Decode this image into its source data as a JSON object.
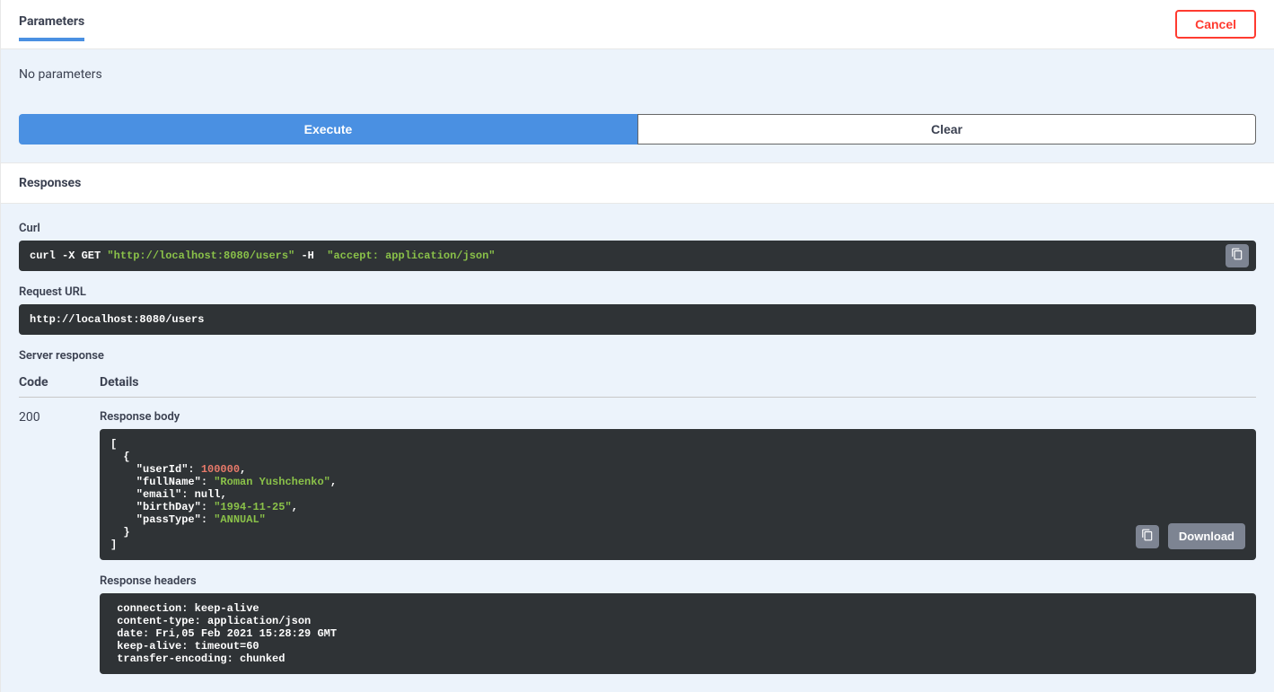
{
  "header": {
    "tab_title": "Parameters",
    "cancel_label": "Cancel"
  },
  "parameters": {
    "no_params_text": "No parameters",
    "execute_label": "Execute",
    "clear_label": "Clear"
  },
  "responses": {
    "title": "Responses",
    "curl_label": "Curl",
    "curl": {
      "prefix": "curl -X GET ",
      "url": "\"http://localhost:8080/users\"",
      "mid": " -H  ",
      "header": "\"accept: application/json\""
    },
    "request_url_label": "Request URL",
    "request_url": "http://localhost:8080/users",
    "server_response_label": "Server response",
    "col_code": "Code",
    "col_details": "Details",
    "status_code": "200",
    "response_body_label": "Response body",
    "response_body": {
      "l1": "[",
      "l2": "  {",
      "l3k": "    \"userId\"",
      "l3c": ": ",
      "l3v": "100000",
      "l3e": ",",
      "l4k": "    \"fullName\"",
      "l4c": ": ",
      "l4v": "\"Roman Yushchenko\"",
      "l4e": ",",
      "l5k": "    \"email\"",
      "l5c": ": ",
      "l5v": "null",
      "l5e": ",",
      "l6k": "    \"birthDay\"",
      "l6c": ": ",
      "l6v": "\"1994-11-25\"",
      "l6e": ",",
      "l7k": "    \"passType\"",
      "l7c": ": ",
      "l7v": "\"ANNUAL\"",
      "l8": "  }",
      "l9": "]"
    },
    "download_label": "Download",
    "response_headers_label": "Response headers",
    "response_headers": " connection: keep-alive \n content-type: application/json \n date: Fri,05 Feb 2021 15:28:29 GMT \n keep-alive: timeout=60 \n transfer-encoding: chunked "
  }
}
